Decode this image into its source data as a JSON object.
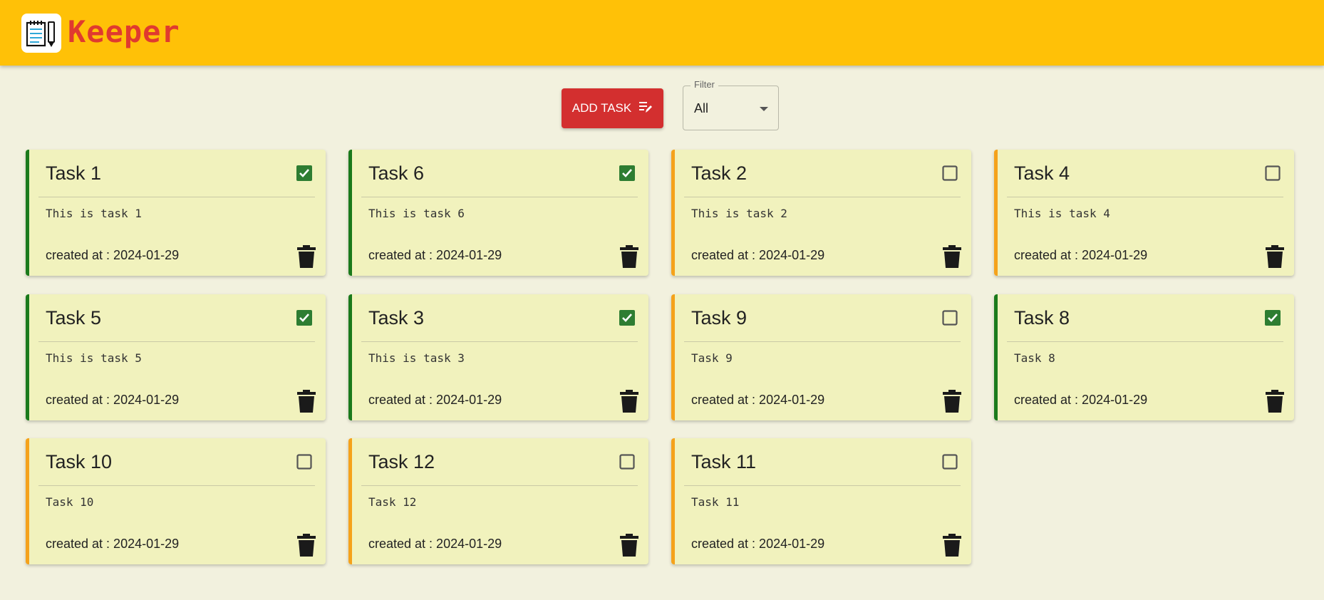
{
  "header": {
    "title": "Keeper"
  },
  "toolbar": {
    "add_label": "ADD TASK",
    "filter": {
      "label": "Filter",
      "value": "All"
    }
  },
  "colors": {
    "done": "#1b7a1b",
    "pending": "#f5a21b",
    "accent": "#d32f2f",
    "header": "#ffc107"
  },
  "created_prefix": "created at : ",
  "tasks": [
    {
      "title": "Task 1",
      "description": "This is task 1",
      "created": "created at : 2024-01-29",
      "done": true
    },
    {
      "title": "Task 6",
      "description": "This is task 6",
      "created": "created at : 2024-01-29",
      "done": true
    },
    {
      "title": "Task 2",
      "description": "This is task 2",
      "created": "created at : 2024-01-29",
      "done": false
    },
    {
      "title": "Task 4",
      "description": "This is task 4",
      "created": "created at : 2024-01-29",
      "done": false
    },
    {
      "title": "Task 5",
      "description": "This is task 5",
      "created": "created at : 2024-01-29",
      "done": true
    },
    {
      "title": "Task 3",
      "description": "This is task 3",
      "created": "created at : 2024-01-29",
      "done": true
    },
    {
      "title": "Task 9",
      "description": "Task 9",
      "created": "created at : 2024-01-29",
      "done": false
    },
    {
      "title": "Task 8",
      "description": "Task 8",
      "created": "created at : 2024-01-29",
      "done": true
    },
    {
      "title": "Task 10",
      "description": "Task 10",
      "created": "created at : 2024-01-29",
      "done": false
    },
    {
      "title": "Task 12",
      "description": "Task 12",
      "created": "created at : 2024-01-29",
      "done": false
    },
    {
      "title": "Task 11",
      "description": "Task 11",
      "created": "created at : 2024-01-29",
      "done": false
    }
  ]
}
